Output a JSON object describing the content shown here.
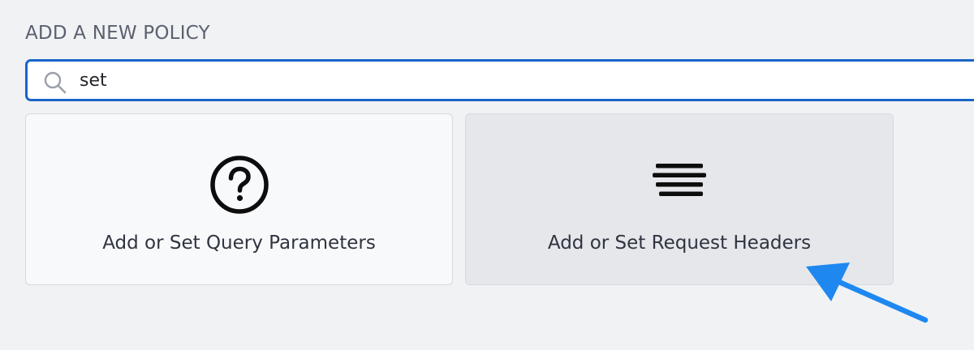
{
  "section": {
    "heading": "ADD A NEW POLICY"
  },
  "search": {
    "value": "set",
    "icon": "search-icon"
  },
  "results": [
    {
      "label": "Add or Set Query Parameters",
      "icon": "question-circle-icon"
    },
    {
      "label": "Add or Set Request Headers",
      "icon": "lines-icon"
    }
  ],
  "colors": {
    "accent": "#1a64c8",
    "annotation_arrow": "#1e88f0",
    "background": "#f1f2f4"
  }
}
